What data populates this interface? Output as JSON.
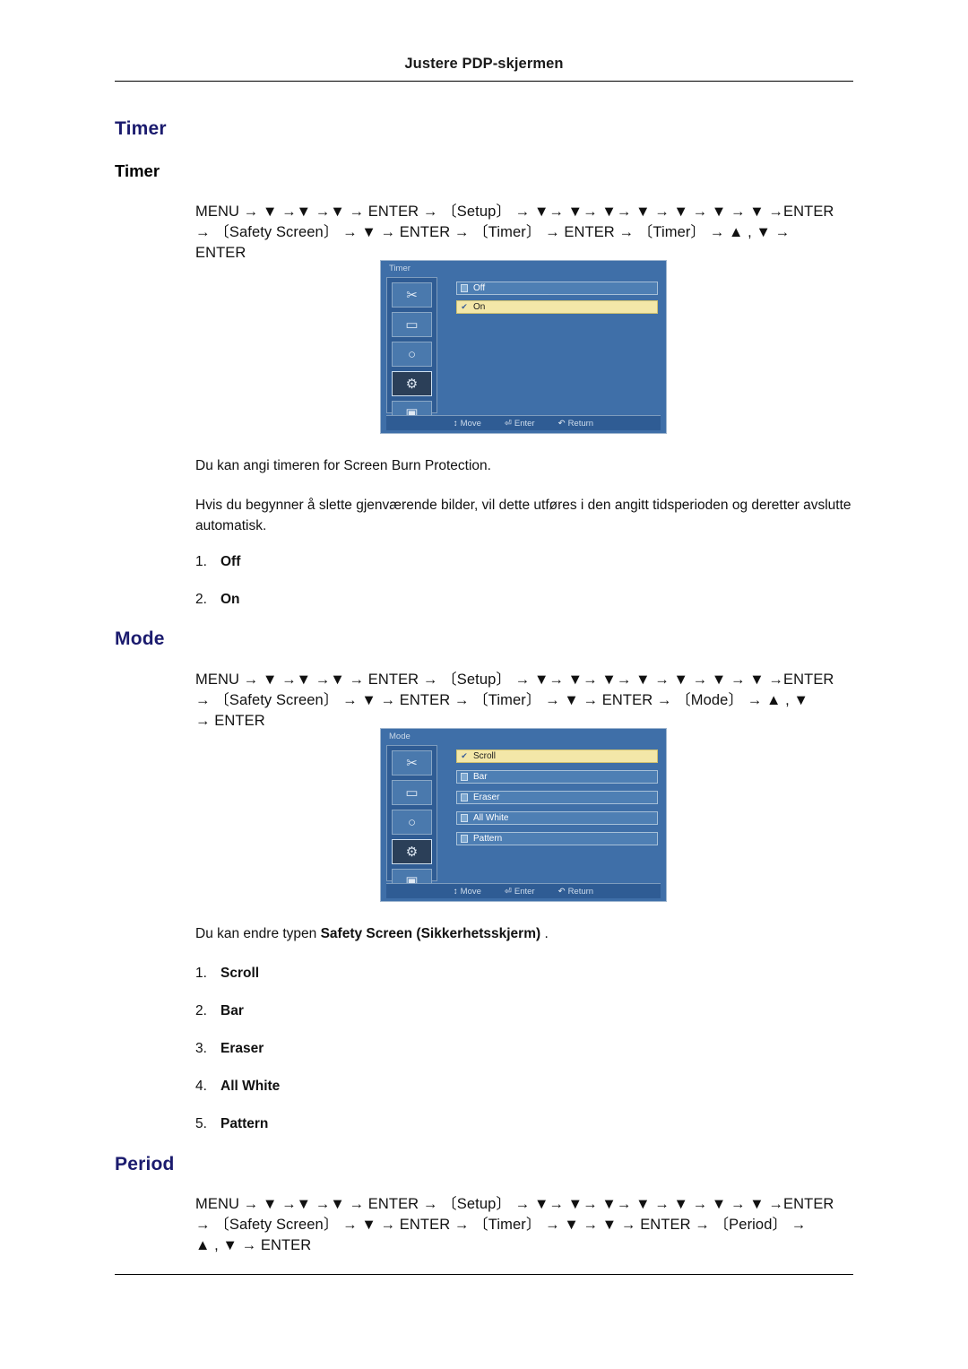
{
  "header": {
    "title": "Justere PDP-skjermen"
  },
  "sections": {
    "timer": {
      "h1": "Timer",
      "h2": "Timer",
      "nav_line1": "MENU →  ▼  →▼  →▼  → ENTER →  〔Setup〕  → ▼→ ▼→ ▼→ ▼ → ▼ → ▼ → ▼ →ENTER",
      "nav_line2": "→ 〔Safety Screen〕 → ▼ → ENTER → 〔Timer〕 → ENTER → 〔Timer〕 → ▲ ,  ▼ →",
      "nav_line3": "ENTER",
      "osd": {
        "title": "Timer",
        "rows": [
          {
            "label": "Off",
            "selected": false
          },
          {
            "label": "On",
            "selected": true
          }
        ],
        "footer": [
          {
            "glyph": "↕",
            "label": "Move"
          },
          {
            "glyph": "⏎",
            "label": "Enter"
          },
          {
            "glyph": "↶",
            "label": "Return"
          }
        ]
      },
      "para1": "Du kan angi timeren for Screen Burn Protection.",
      "para2": "Hvis du begynner å slette gjenværende bilder, vil dette utføres i den angitt tidsperioden og deretter avslutte automatisk.",
      "options": [
        {
          "num": "1.",
          "label": "Off"
        },
        {
          "num": "2.",
          "label": "On"
        }
      ]
    },
    "mode": {
      "h1": "Mode",
      "nav_line1": "MENU →  ▼  →▼   →▼  → ENTER →  〔Setup〕  → ▼→ ▼→ ▼→ ▼ → ▼ → ▼ → ▼ →ENTER",
      "nav_line2": "→ 〔Safety Screen〕 → ▼ → ENTER → 〔Timer〕 → ▼ → ENTER → 〔Mode〕 → ▲ ,  ▼",
      "nav_line3": "→ ENTER",
      "osd": {
        "title": "Mode",
        "rows": [
          {
            "label": "Scroll",
            "selected": true
          },
          {
            "label": "Bar",
            "selected": false
          },
          {
            "label": "Eraser",
            "selected": false
          },
          {
            "label": "All White",
            "selected": false
          },
          {
            "label": "Pattern",
            "selected": false
          }
        ],
        "footer": [
          {
            "glyph": "↕",
            "label": "Move"
          },
          {
            "glyph": "⏎",
            "label": "Enter"
          },
          {
            "glyph": "↶",
            "label": "Return"
          }
        ]
      },
      "para1_plain": "Du kan endre typen ",
      "para1_bold": "Safety Screen (Sikkerhetsskjerm)",
      "para1_tail": " .",
      "options": [
        {
          "num": "1.",
          "label": "Scroll"
        },
        {
          "num": "2.",
          "label": "Bar"
        },
        {
          "num": "3.",
          "label": "Eraser"
        },
        {
          "num": "4.",
          "label": "All White"
        },
        {
          "num": "5.",
          "label": "Pattern"
        }
      ]
    },
    "period": {
      "h1": "Period",
      "nav_line1": "MENU →  ▼  →▼   →▼  → ENTER →  〔Setup〕  → ▼→ ▼→ ▼→ ▼ → ▼ → ▼ → ▼ →ENTER",
      "nav_line2": "→ 〔Safety Screen〕 → ▼ → ENTER → 〔Timer〕 → ▼ → ▼ → ENTER → 〔Period〕 →",
      "nav_line3": "▲ ,  ▼ → ENTER"
    }
  },
  "osd_icons": [
    "✂",
    "▭",
    "○",
    "⚙",
    "▣"
  ]
}
